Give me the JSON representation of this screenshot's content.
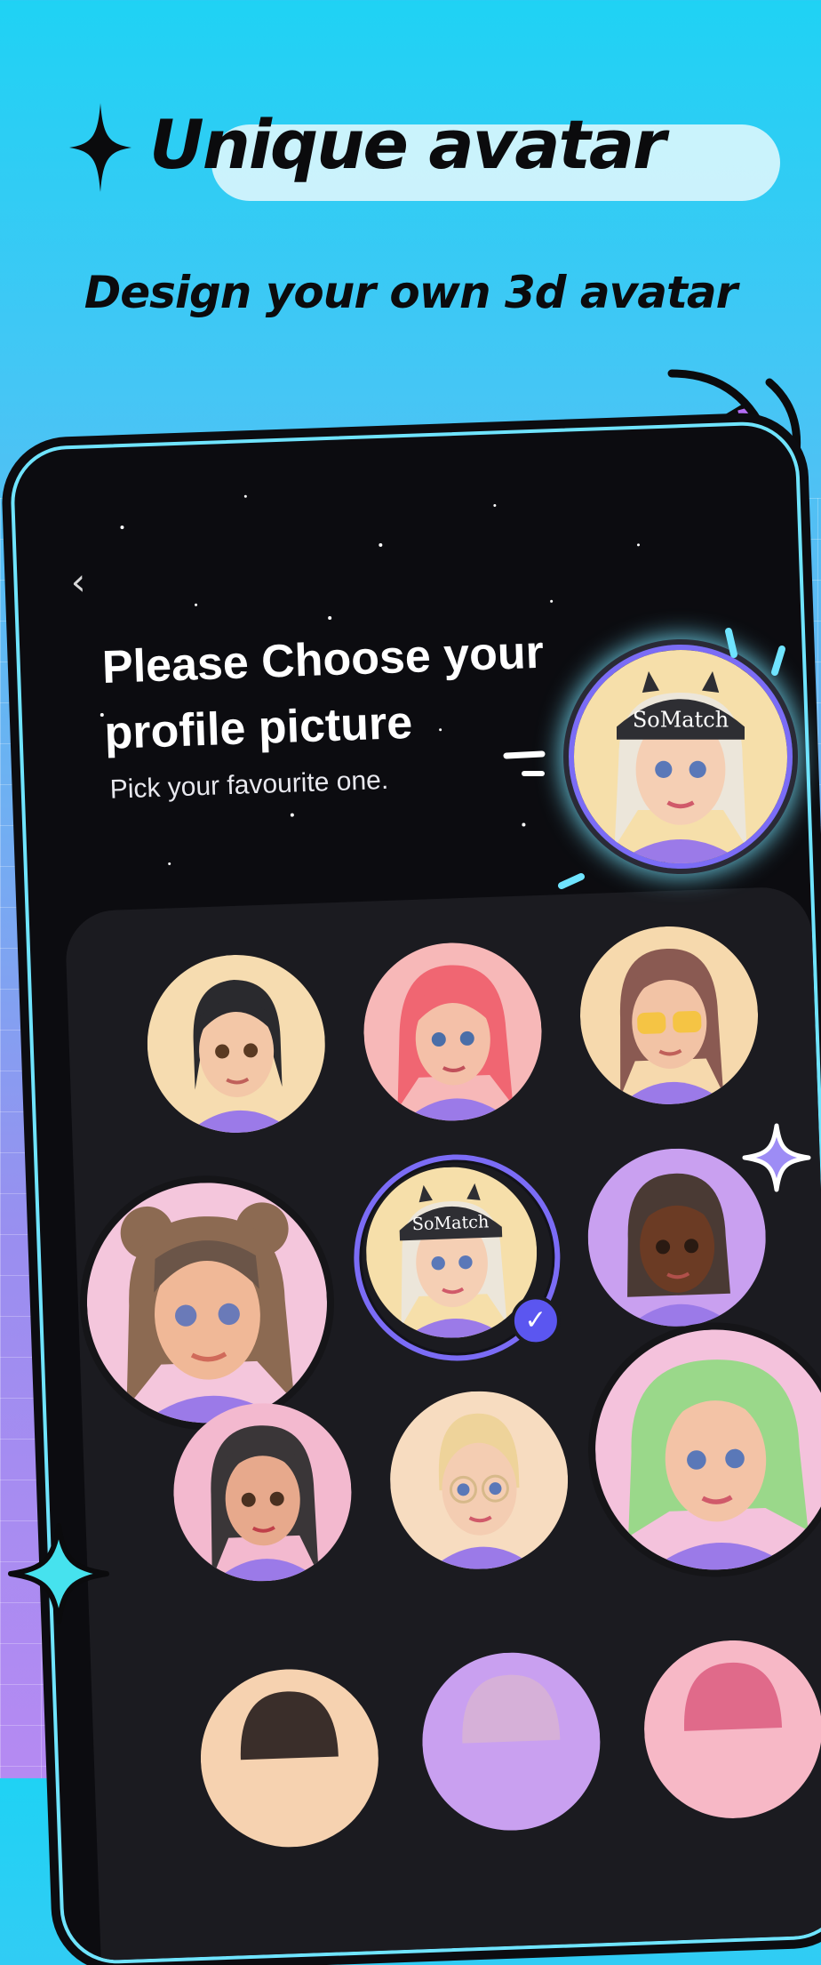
{
  "headline": {
    "title": "Unique avatar",
    "subtitle": "Design your own 3d avatar"
  },
  "screen": {
    "title": "Please Choose your profile picture",
    "subtitle": "Pick your favourite one."
  },
  "avatars": [
    {
      "hair": "black bangs",
      "skin": "#f3c7a7",
      "bg": "#f6dcb0"
    },
    {
      "hair": "pink",
      "skin": "#f4c0a8",
      "bg": "#f7b8b8"
    },
    {
      "hair": "brown yellow glasses",
      "skin": "#f2c3a5",
      "bg": "#f6d9ad"
    },
    {
      "hair": "brown bear ears",
      "skin": "#f0b897",
      "bg": "#f4c6dc"
    },
    {
      "hair": "platinum SoMatch cap",
      "skin": "#f5cfb4",
      "bg": "#f6dfaa",
      "selected": true,
      "cap_text": "SoMatch"
    },
    {
      "hair": "dark bob",
      "skin": "#6b3b24",
      "bg": "#c9a0f0"
    },
    {
      "hair": "long black",
      "skin": "#e7a98c",
      "bg": "#f3b9cf"
    },
    {
      "hair": "blonde glasses",
      "skin": "#f4cdb2",
      "bg": "#f7dcc0"
    },
    {
      "hair": "green wavy",
      "skin": "#f3c3a6",
      "bg": "#f4c2dc"
    }
  ],
  "preview": {
    "cap_text": "SoMatch"
  },
  "colors": {
    "accent": "#7b6cf6",
    "panel": "#1b1b20",
    "glow": "#6fe4ff"
  }
}
